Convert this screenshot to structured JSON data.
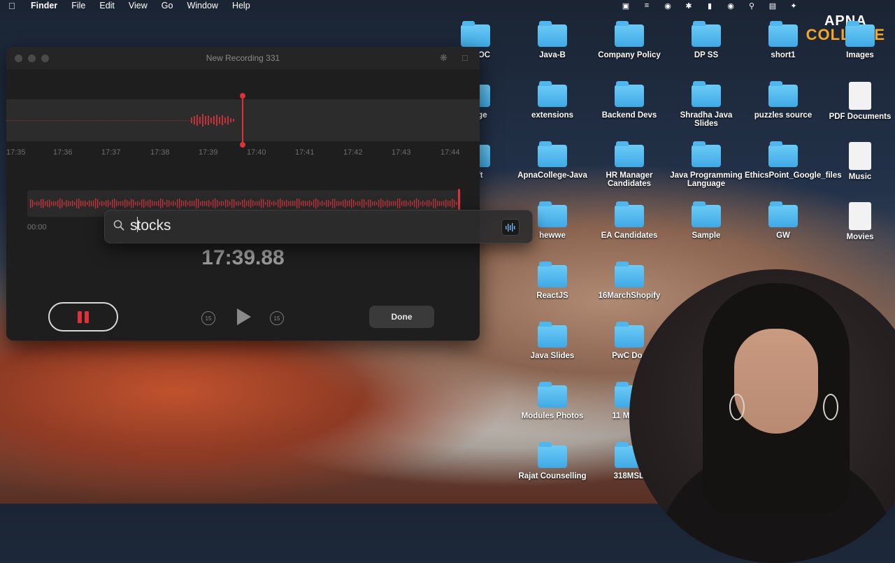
{
  "menubar": {
    "app": "Finder",
    "items": [
      "File",
      "Edit",
      "View",
      "Go",
      "Window",
      "Help"
    ],
    "status_icons": [
      "record-stop-icon",
      "clipboard-icon",
      "globe-icon",
      "bluetooth-icon",
      "battery-icon",
      "user-icon",
      "search-icon",
      "control-center-icon",
      "siri-icon"
    ]
  },
  "logo": {
    "line1": "APNA",
    "line2": "COLLEGE"
  },
  "desktop": {
    "icons": [
      {
        "label": "ge-POC",
        "kind": "folder"
      },
      {
        "label": "Java-B",
        "kind": "folder"
      },
      {
        "label": "Company Policy",
        "kind": "folder"
      },
      {
        "label": "DP SS",
        "kind": "folder"
      },
      {
        "label": "short1",
        "kind": "folder"
      },
      {
        "label": "Images",
        "kind": "folder"
      },
      {
        "label": "ollege",
        "kind": "folder"
      },
      {
        "label": "extensions",
        "kind": "folder"
      },
      {
        "label": "Backend Devs",
        "kind": "folder"
      },
      {
        "label": "Shradha Java Slides",
        "kind": "folder"
      },
      {
        "label": "puzzles source",
        "kind": "folder"
      },
      {
        "label": "PDF Documents",
        "kind": "document"
      },
      {
        "label": "soft",
        "kind": "folder"
      },
      {
        "label": "ApnaCollege-Java",
        "kind": "folder"
      },
      {
        "label": "HR Manager Candidates",
        "kind": "folder"
      },
      {
        "label": "Java Programming Language",
        "kind": "folder"
      },
      {
        "label": "EthicsPoint_Google_files",
        "kind": "folder"
      },
      {
        "label": "Music",
        "kind": "document"
      },
      {
        "label": "hewwe",
        "kind": "folder"
      },
      {
        "label": "EA Candidates",
        "kind": "folder"
      },
      {
        "label": "Sample",
        "kind": "folder"
      },
      {
        "label": "GW",
        "kind": "folder"
      },
      {
        "label": "Movies",
        "kind": "document"
      },
      {
        "label": "ReactJS",
        "kind": "folder"
      },
      {
        "label": "16MarchShopify",
        "kind": "folder"
      },
      {
        "label": "Java Slides",
        "kind": "folder"
      },
      {
        "label": "PwC Doc",
        "kind": "folder"
      },
      {
        "label": "Modules Photos",
        "kind": "folder"
      },
      {
        "label": "11 March",
        "kind": "folder"
      },
      {
        "label": "Rajat Counselling",
        "kind": "folder"
      },
      {
        "label": "318MSD",
        "kind": "folder"
      }
    ]
  },
  "recorder": {
    "title": "New Recording 331",
    "timeline_ticks": [
      "17:35",
      "17:36",
      "17:37",
      "17:38",
      "17:39",
      "17:40",
      "17:41",
      "17:42",
      "17:43",
      "17:44"
    ],
    "overview_start": "00:00",
    "elapsed": "17:39.88",
    "skip_back": "15",
    "skip_forward": "15",
    "done_label": "Done"
  },
  "spotlight": {
    "query_first": "s",
    "query_rest": "tocks"
  },
  "colors": {
    "accent_red": "#e0303a",
    "folder_blue": "#4fb6ee",
    "logo_orange": "#f5a623"
  }
}
